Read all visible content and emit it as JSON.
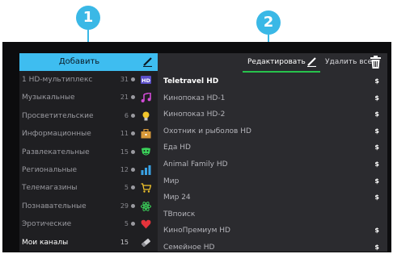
{
  "markers": [
    {
      "label": "1"
    },
    {
      "label": "2"
    }
  ],
  "sidebar": {
    "add_label": "Добавить",
    "categories": [
      {
        "name": "1 HD-мультиплекс",
        "count": "31",
        "icon": "hd-icon"
      },
      {
        "name": "Музыкальные",
        "count": "21",
        "icon": "music-note-icon"
      },
      {
        "name": "Просветительские",
        "count": "6",
        "icon": "lightbulb-icon"
      },
      {
        "name": "Информационные",
        "count": "11",
        "icon": "briefcase-icon"
      },
      {
        "name": "Развлекательные",
        "count": "15",
        "icon": "theater-masks-icon"
      },
      {
        "name": "Региональные",
        "count": "12",
        "icon": "bar-chart-icon"
      },
      {
        "name": "Телемагазины",
        "count": "5",
        "icon": "shopping-cart-icon"
      },
      {
        "name": "Познавательные",
        "count": "29",
        "icon": "atom-icon"
      },
      {
        "name": "Эротические",
        "count": "5",
        "icon": "heart-icon"
      },
      {
        "name": "Мои каналы",
        "count": "15",
        "icon": "eraser-icon",
        "selected": true
      }
    ]
  },
  "toolbar": {
    "edit_label": "Редактировать",
    "delete_all_label": "Удалить все"
  },
  "channels": [
    {
      "name": "Teletravel HD",
      "price": "$",
      "selected": true
    },
    {
      "name": "Кинопоказ HD-1",
      "price": "$"
    },
    {
      "name": "Кинопоказ HD-2",
      "price": "$"
    },
    {
      "name": "Охотник и рыболов HD",
      "price": "$"
    },
    {
      "name": "Еда HD",
      "price": "$"
    },
    {
      "name": "Animal Family HD",
      "price": "$"
    },
    {
      "name": "Мир",
      "price": "$"
    },
    {
      "name": "Мир 24",
      "price": "$"
    },
    {
      "name": "ТВпоиск",
      "price": ""
    },
    {
      "name": "КиноПремиум HD",
      "price": "$"
    },
    {
      "name": "Семейное HD",
      "price": "$"
    }
  ],
  "colors": {
    "accent": "#3ebdf0",
    "active_underline": "#27c24c",
    "panel": "#2b2b2f",
    "sidebar": "#1f1f22"
  }
}
